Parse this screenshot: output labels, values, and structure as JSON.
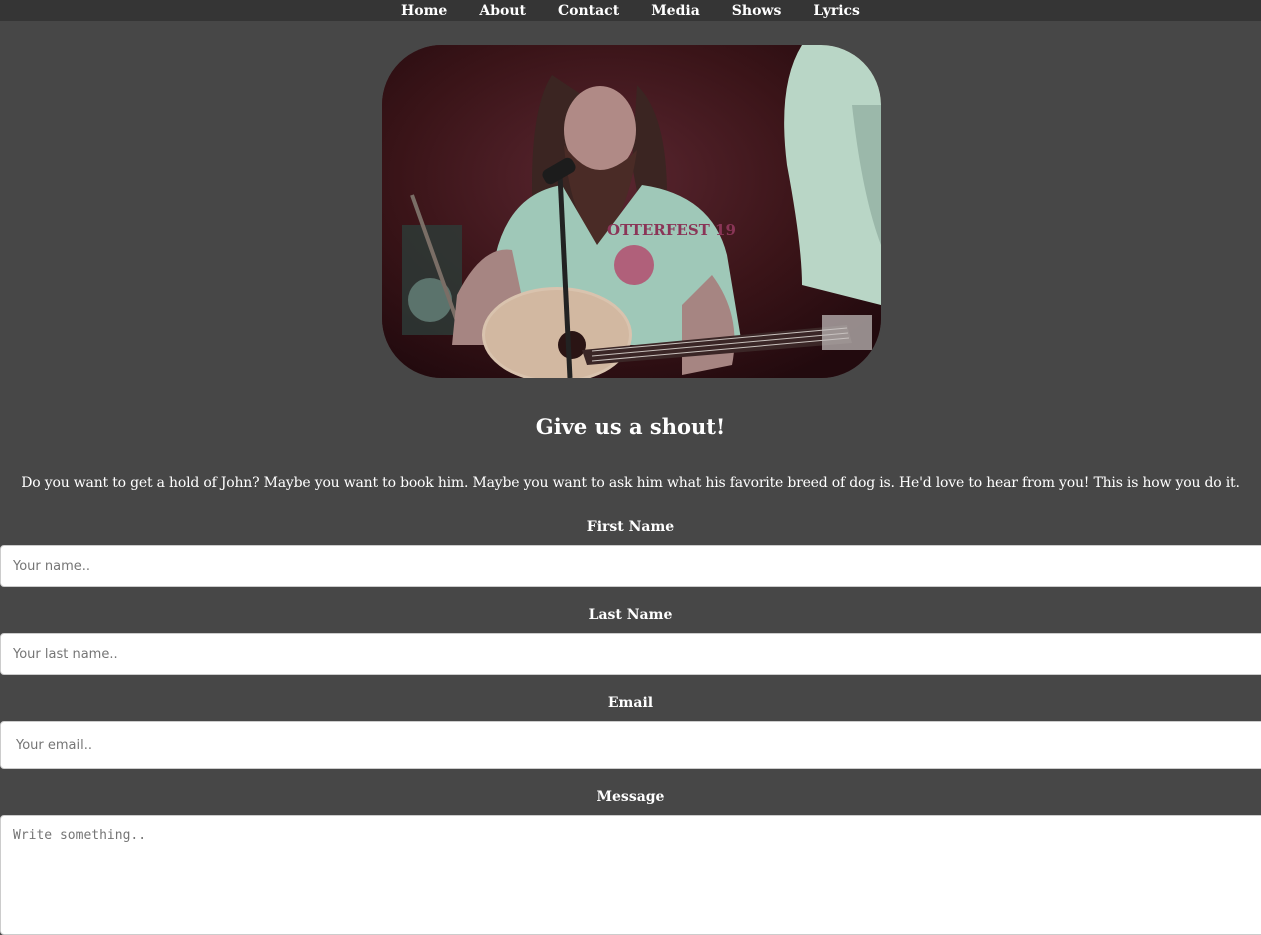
{
  "nav": {
    "items": [
      "Home",
      "About",
      "Contact",
      "Media",
      "Shows",
      "Lyrics"
    ]
  },
  "hero": {
    "image_icon": "musician-photo",
    "shirt_text": "OTTERFEST 19"
  },
  "page": {
    "title": "Give us a shout!",
    "intro": "Do you want to get a hold of John? Maybe you want to book him. Maybe you want to ask him what his favorite breed of dog is. He'd love to hear from you! This is how you do it."
  },
  "form": {
    "first_name": {
      "label": "First Name",
      "placeholder": "Your name..",
      "value": ""
    },
    "last_name": {
      "label": "Last Name",
      "placeholder": "Your last name..",
      "value": ""
    },
    "email": {
      "label": "Email",
      "placeholder": "Your email..",
      "value": ""
    },
    "message": {
      "label": "Message",
      "placeholder": "Write something..",
      "value": ""
    }
  },
  "colors": {
    "background": "#474747",
    "nav_background": "#353535",
    "text": "#ffffff",
    "input_background": "#ffffff"
  }
}
